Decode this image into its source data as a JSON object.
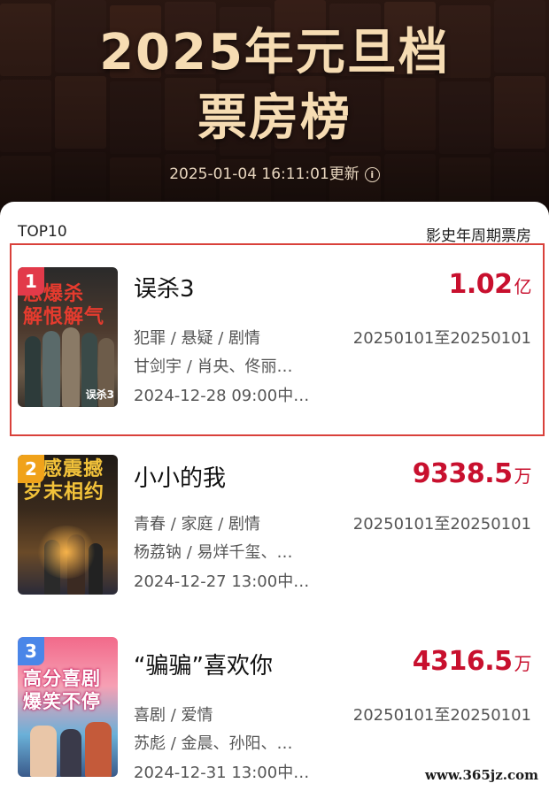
{
  "header": {
    "title_line1": "2025年元旦档",
    "title_line2": "票房榜",
    "updated": "2025-01-04 16:11:01更新",
    "info_icon": "info-icon"
  },
  "list": {
    "left_label": "TOP10",
    "right_label": "影史年周期票房",
    "highlight_color": "#d9413b",
    "box_color": "#c8102e",
    "items": [
      {
        "rank": "1",
        "badge_color": "#e23a4a",
        "poster_text": [
          "恶爆杀",
          "解恨解气"
        ],
        "poster_corner": "误杀3",
        "title": "误杀3",
        "box_value": "1.02",
        "box_unit": "亿",
        "genres": "犯罪 / 悬疑 / 剧情",
        "period": "20250101至20250101",
        "cast": "甘剑宇 / 肖央、佟丽…",
        "release": "2024-12-28 09:00中…"
      },
      {
        "rank": "2",
        "badge_color": "#f0a21a",
        "poster_text": [
          "感震撼",
          "岁末相约"
        ],
        "title": "小小的我",
        "box_value": "9338.5",
        "box_unit": "万",
        "genres": "青春 / 家庭 / 剧情",
        "period": "20250101至20250101",
        "cast": "杨荔钠 / 易烊千玺、…",
        "release": "2024-12-27 13:00中…"
      },
      {
        "rank": "3",
        "badge_color": "#4a86e8",
        "poster_text": [
          "高分喜剧",
          "爆笑不停"
        ],
        "title": "“骗骗”喜欢你",
        "box_value": "4316.5",
        "box_unit": "万",
        "genres": "喜剧 / 爱情",
        "period": "20250101至20250101",
        "cast": "苏彪 / 金晨、孙阳、…",
        "release": "2024-12-31 13:00中…"
      }
    ]
  },
  "watermark": "www.365jz.com"
}
